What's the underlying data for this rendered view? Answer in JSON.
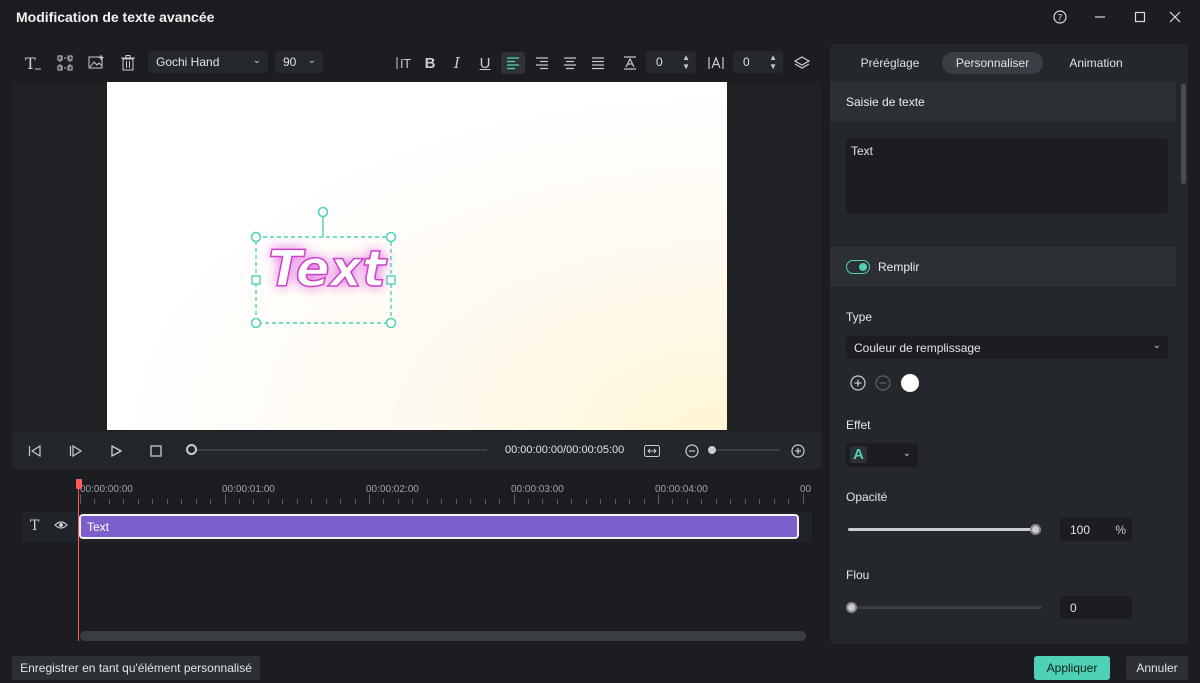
{
  "window": {
    "title": "Modification de texte avancée"
  },
  "toolbar": {
    "font": "Gochi Hand",
    "size": "90",
    "line_spacing": "0",
    "char_spacing": "0"
  },
  "preview": {
    "text": "Text"
  },
  "player": {
    "timecode": "00:00:00:00/00:00:05:00"
  },
  "timeline": {
    "ruler": [
      "00:00:00:00",
      "00:00:01:00",
      "00:00:02:00",
      "00:00:03:00",
      "00:00:04:00",
      "00"
    ],
    "clip_label": "Text"
  },
  "panel": {
    "tabs": [
      "Préréglage",
      "Personnaliser",
      "Animation"
    ],
    "active_tab": "Personnaliser",
    "text_entry_title": "Saisie de texte",
    "text_value": "Text",
    "fill_label": "Remplir",
    "type_label": "Type",
    "type_value": "Couleur de remplissage",
    "effect_label": "Effet",
    "effect_glyph": "A",
    "opacity_label": "Opacité",
    "opacity_value": "100",
    "opacity_unit": "%",
    "opacity_level": 1.0,
    "blur_label": "Flou",
    "blur_value": "0",
    "blur_level": 0.0
  },
  "footer": {
    "save_custom": "Enregistrer en tant qu'élément personnalisé",
    "apply": "Appliquer",
    "cancel": "Annuler"
  },
  "colors": {
    "accent": "#4fd1b5",
    "clip": "#7c5fcc",
    "playhead": "#ff5a5a",
    "glow": "#d94cd9"
  }
}
